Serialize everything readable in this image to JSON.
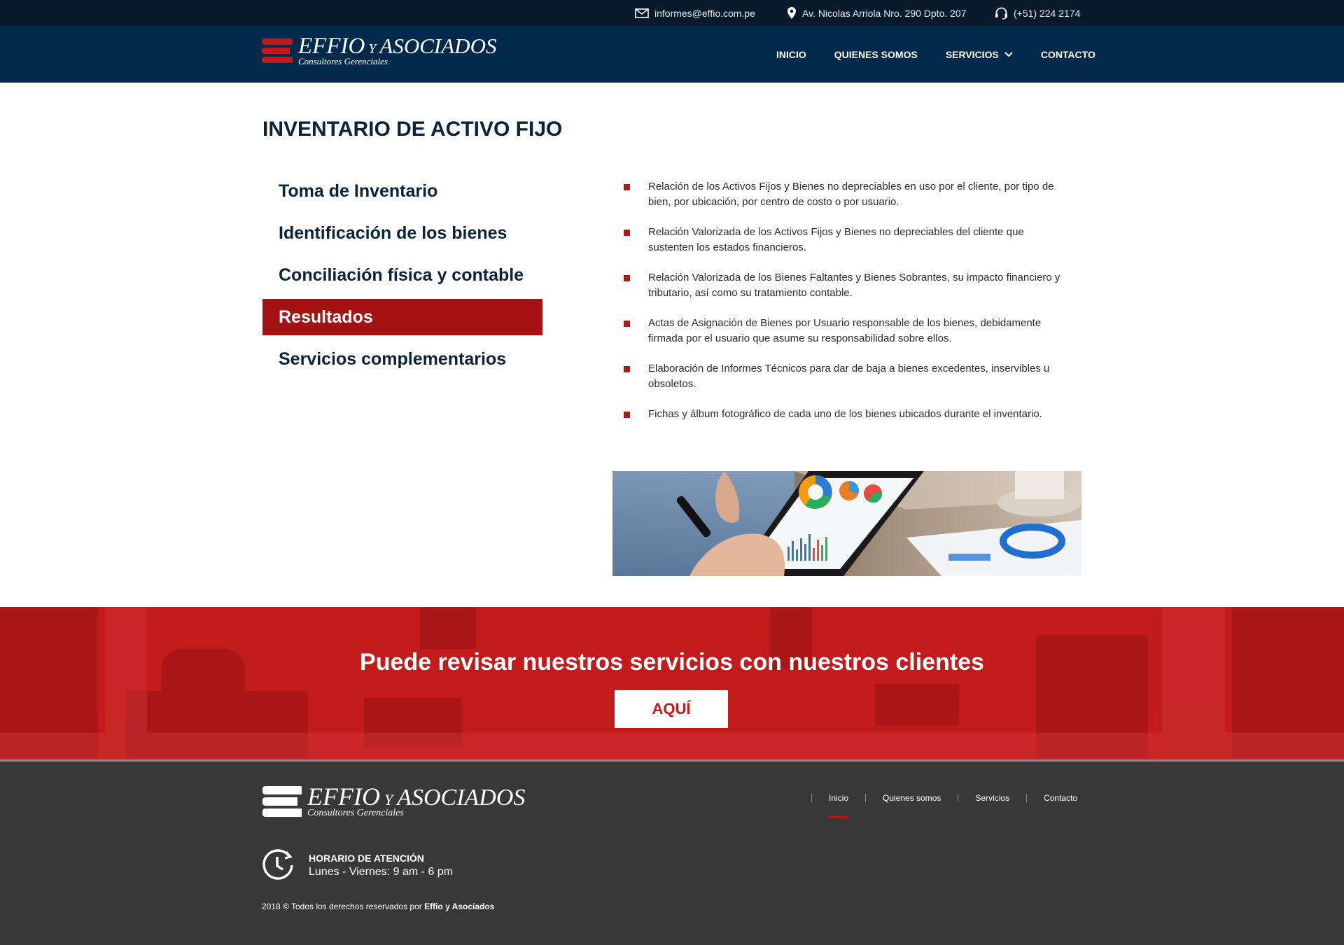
{
  "colors": {
    "navy_dark": "#081a2b",
    "navy": "#032a4a",
    "accent_red": "#a51212",
    "banner_red": "#c31a1b",
    "footer_gray": "#383838"
  },
  "topbar": {
    "email": "informes@effio.com.pe",
    "address": "Av. Nicolas Arriola Nro. 290 Dpto. 207",
    "phone": "(+51) 224 2174",
    "icons": [
      "envelope-icon",
      "map-pin-icon",
      "headset-icon"
    ]
  },
  "brand": {
    "name_effio": "EFFIO",
    "name_y": "Y",
    "name_asociados": "ASOCIADOS",
    "tagline": "Consultores Gerenciales"
  },
  "nav": {
    "items": [
      "INICIO",
      "QUIENES SOMOS",
      "SERVICIOS",
      "CONTACTO"
    ]
  },
  "page": {
    "title_prefix": "INVENTARIO DE ",
    "title_bold": "ACTIVO FIJO"
  },
  "side_menu": {
    "items": [
      "Toma de Inventario",
      "Identificación de los bienes",
      "Conciliación física y contable",
      "Resultados",
      "Servicios complementarios"
    ],
    "active": "Resultados"
  },
  "results": {
    "items": [
      "Relación de los Activos Fijos y Bienes no depreciables en uso por el cliente, por tipo de bien, por ubicación, por centro de costo o por usuario.",
      "Relación Valorizada de los Activos Fijos y Bienes no depreciables del cliente que sustenten los estados financieros.",
      "Relación Valorizada de los Bienes Faltantes y Bienes Sobrantes, su impacto financiero y tributario, así como su tratamiento contable.",
      "Actas de Asignación de Bienes por Usuario responsable de los bienes, debidamente firmada por el usuario que asume su responsabilidad sobre ellos.",
      "Elaboración de Informes Técnicos para dar de baja a bienes excedentes, inservibles u obsoletos.",
      "Fichas y álbum fotográfico de cada uno de los bienes ubicados durante el inventario."
    ]
  },
  "banner": {
    "title": "Puede revisar nuestros servicios con nuestros clientes",
    "button": "AQUÍ"
  },
  "footer": {
    "nav": [
      "Inicio",
      "Quienes somos",
      "Servicios",
      "Contacto"
    ],
    "active": "Inicio",
    "hours_label": "HORARIO DE ATENCIÓN",
    "hours_value": "Lunes - Viernes: 9 am - 6 pm",
    "copyright_prefix": "2018 © Todos los derechos reservados por ",
    "copyright_brand": "Effio y Asociados"
  }
}
